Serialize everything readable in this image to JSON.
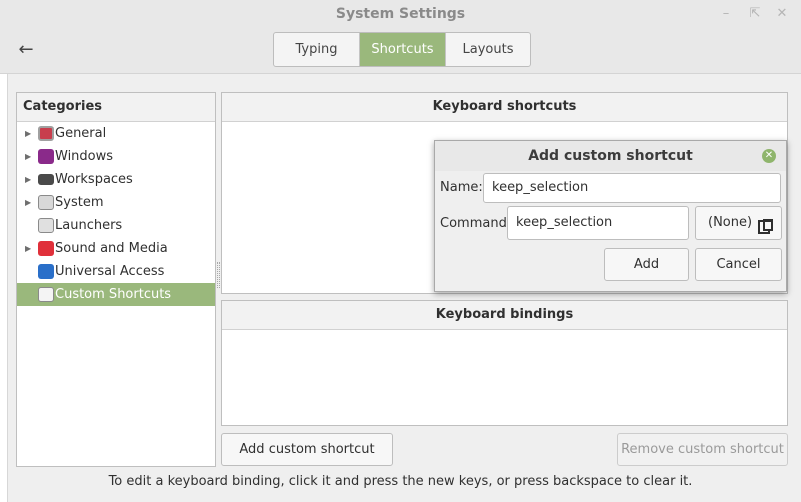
{
  "window": {
    "title": "System Settings"
  },
  "tabs": [
    {
      "label": "Typing",
      "active": false
    },
    {
      "label": "Shortcuts",
      "active": true
    },
    {
      "label": "Layouts",
      "active": false
    }
  ],
  "categories": {
    "header": "Categories",
    "items": [
      {
        "label": "General",
        "icon": "general-icon",
        "expandable": true,
        "selected": false
      },
      {
        "label": "Windows",
        "icon": "windows-icon",
        "expandable": true,
        "selected": false
      },
      {
        "label": "Workspaces",
        "icon": "workspaces-icon",
        "expandable": true,
        "selected": false
      },
      {
        "label": "System",
        "icon": "system-icon",
        "expandable": true,
        "selected": false
      },
      {
        "label": "Launchers",
        "icon": "launchers-icon",
        "expandable": false,
        "selected": false
      },
      {
        "label": "Sound and Media",
        "icon": "sound-media-icon",
        "expandable": true,
        "selected": false
      },
      {
        "label": "Universal Access",
        "icon": "universal-access-icon",
        "expandable": false,
        "selected": false
      },
      {
        "label": "Custom Shortcuts",
        "icon": "custom-shortcuts-icon",
        "expandable": false,
        "selected": true
      }
    ]
  },
  "shortcuts_panel": {
    "header": "Keyboard shortcuts"
  },
  "bindings_panel": {
    "header": "Keyboard bindings"
  },
  "buttons": {
    "add_custom": "Add custom shortcut",
    "remove_custom": "Remove custom shortcut"
  },
  "status_text": "To edit a keyboard binding, click it and press the new keys, or press backspace to clear it.",
  "dialog": {
    "title": "Add custom shortcut",
    "name_label": "Name:",
    "name_value": "keep_selection",
    "command_label": "Command:",
    "command_value": "keep_selection",
    "browse_label": "(None)",
    "add_label": "Add",
    "cancel_label": "Cancel"
  },
  "colors": {
    "accent": "#9ab87c",
    "close": "#8fb56c"
  }
}
